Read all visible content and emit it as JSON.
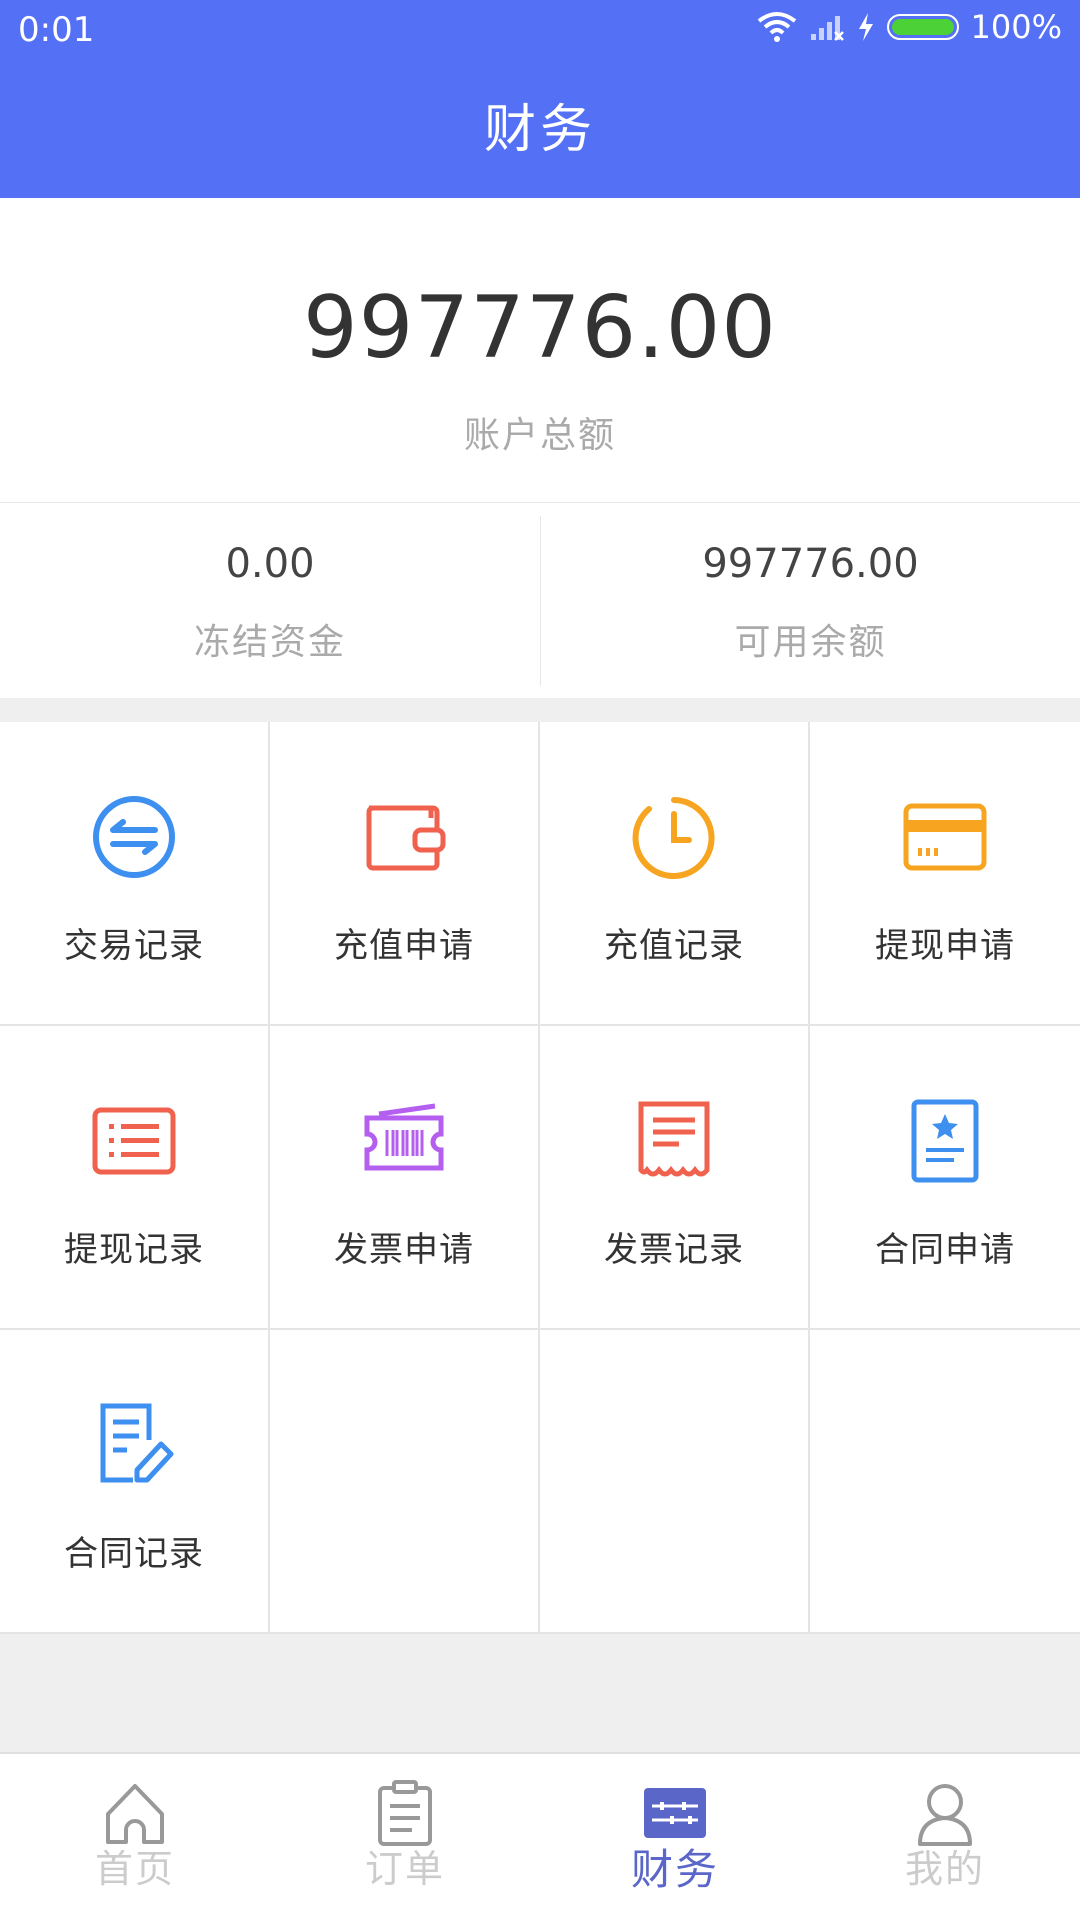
{
  "status_bar": {
    "time": "0:01",
    "battery": "100%"
  },
  "header": {
    "title": "财务"
  },
  "account": {
    "total_amount": "997776.00",
    "total_label": "账户总额",
    "frozen_value": "0.00",
    "frozen_label": "冻结资金",
    "available_value": "997776.00",
    "available_label": "可用余额"
  },
  "menu": {
    "items": [
      {
        "label": "交易记录",
        "icon": "exchange-icon",
        "color": "#3d8ff0"
      },
      {
        "label": "充值申请",
        "icon": "wallet-icon",
        "color": "#f0624d"
      },
      {
        "label": "充值记录",
        "icon": "clock-icon",
        "color": "#f7a521"
      },
      {
        "label": "提现申请",
        "icon": "card-icon",
        "color": "#f7a521"
      },
      {
        "label": "提现记录",
        "icon": "list-icon",
        "color": "#f0624d"
      },
      {
        "label": "发票申请",
        "icon": "ticket-icon",
        "color": "#b45ff0"
      },
      {
        "label": "发票记录",
        "icon": "receipt-icon",
        "color": "#f0624d"
      },
      {
        "label": "合同申请",
        "icon": "contract-star-icon",
        "color": "#3d8ff0"
      },
      {
        "label": "合同记录",
        "icon": "contract-edit-icon",
        "color": "#3d8ff0"
      }
    ]
  },
  "tabbar": {
    "tabs": [
      {
        "label": "首页",
        "icon": "home-icon"
      },
      {
        "label": "订单",
        "icon": "order-icon"
      },
      {
        "label": "财务",
        "icon": "finance-icon",
        "active": true
      },
      {
        "label": "我的",
        "icon": "profile-icon"
      }
    ],
    "active_color": "#5a67c8"
  }
}
